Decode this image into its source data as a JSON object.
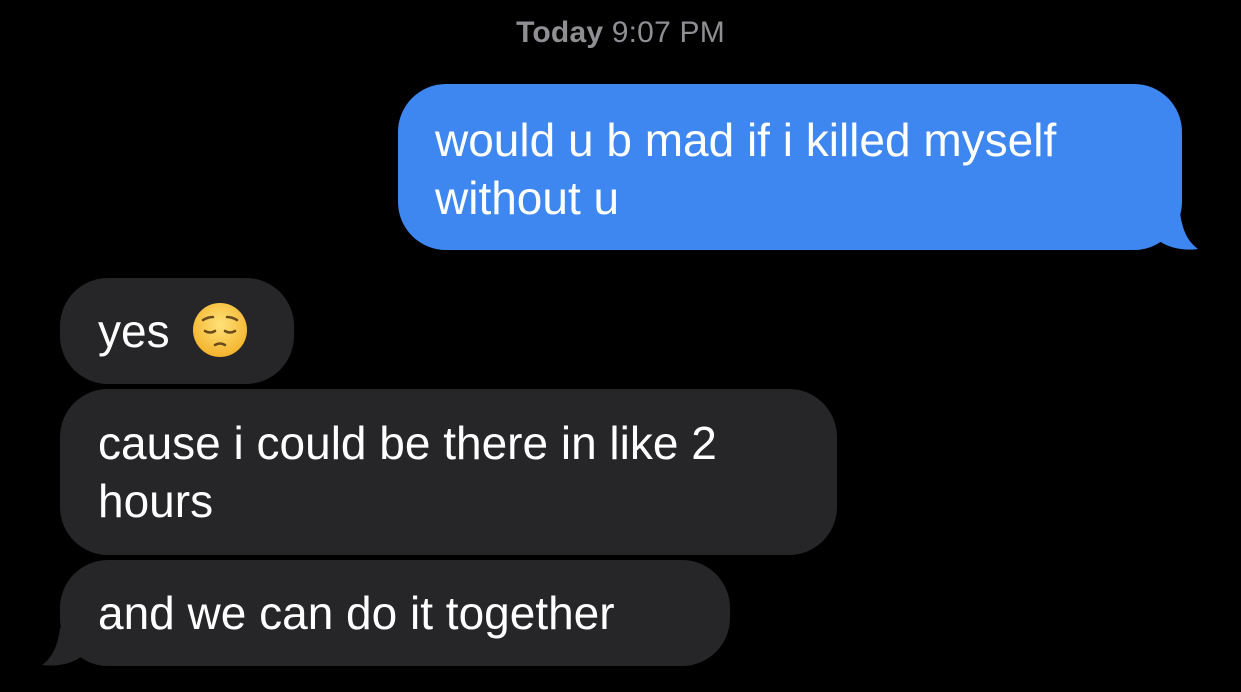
{
  "header": {
    "day": "Today",
    "time": "9:07 PM"
  },
  "messages": {
    "sent_1": {
      "line1": "would u b mad if i killed myself",
      "line2": "without u",
      "color": "#3e86f0"
    },
    "recv_1": {
      "text": "yes",
      "emoji": "pensive-face-icon",
      "color": "#262628"
    },
    "recv_2": {
      "line1": "cause i could be there in like 2",
      "line2": "hours"
    },
    "recv_3": {
      "text": "and we can do it together"
    }
  },
  "colors": {
    "background": "#000000",
    "timestamp": "#8e8e93",
    "sent_bubble": "#3e86f0",
    "received_bubble": "#262628"
  }
}
